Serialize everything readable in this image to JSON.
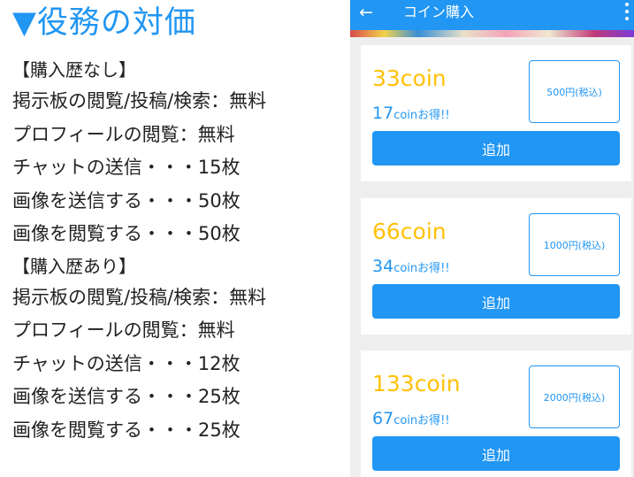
{
  "article": {
    "heading": "役務の対価",
    "heading_marker": "▼",
    "sections": [
      {
        "label": "【購入歴なし】",
        "lines": [
          "掲示板の閲覧/投稿/検索：無料",
          "プロフィールの閲覧：無料",
          "チャットの送信・・・15枚",
          "画像を送信する・・・50枚",
          "画像を閲覧する・・・50枚"
        ]
      },
      {
        "label": "【購入歴あり】",
        "lines": [
          "掲示板の閲覧/投稿/検索：無料",
          "プロフィールの閲覧：無料",
          "チャットの送信・・・12枚",
          "画像を送信する・・・25枚",
          "画像を閲覧する・・・25枚"
        ]
      }
    ]
  },
  "phone": {
    "appbar": {
      "back_icon": "←",
      "title": "コイン購入",
      "more_icon": "more-vertical-icon"
    },
    "plans": [
      {
        "coins": "33coin",
        "bonus_num": "17",
        "bonus_unit": "coinお得!!",
        "price": "500円(税込)",
        "button": "追加"
      },
      {
        "coins": "66coin",
        "bonus_num": "34",
        "bonus_unit": "coinお得!!",
        "price": "1000円(税込)",
        "button": "追加"
      },
      {
        "coins": "133coin",
        "bonus_num": "67",
        "bonus_unit": "coinお得!!",
        "price": "2000円(税込)",
        "button": "追加"
      }
    ]
  },
  "colors": {
    "accent": "#2196F3",
    "coin": "#FFC107",
    "background": "#eeeeee"
  }
}
